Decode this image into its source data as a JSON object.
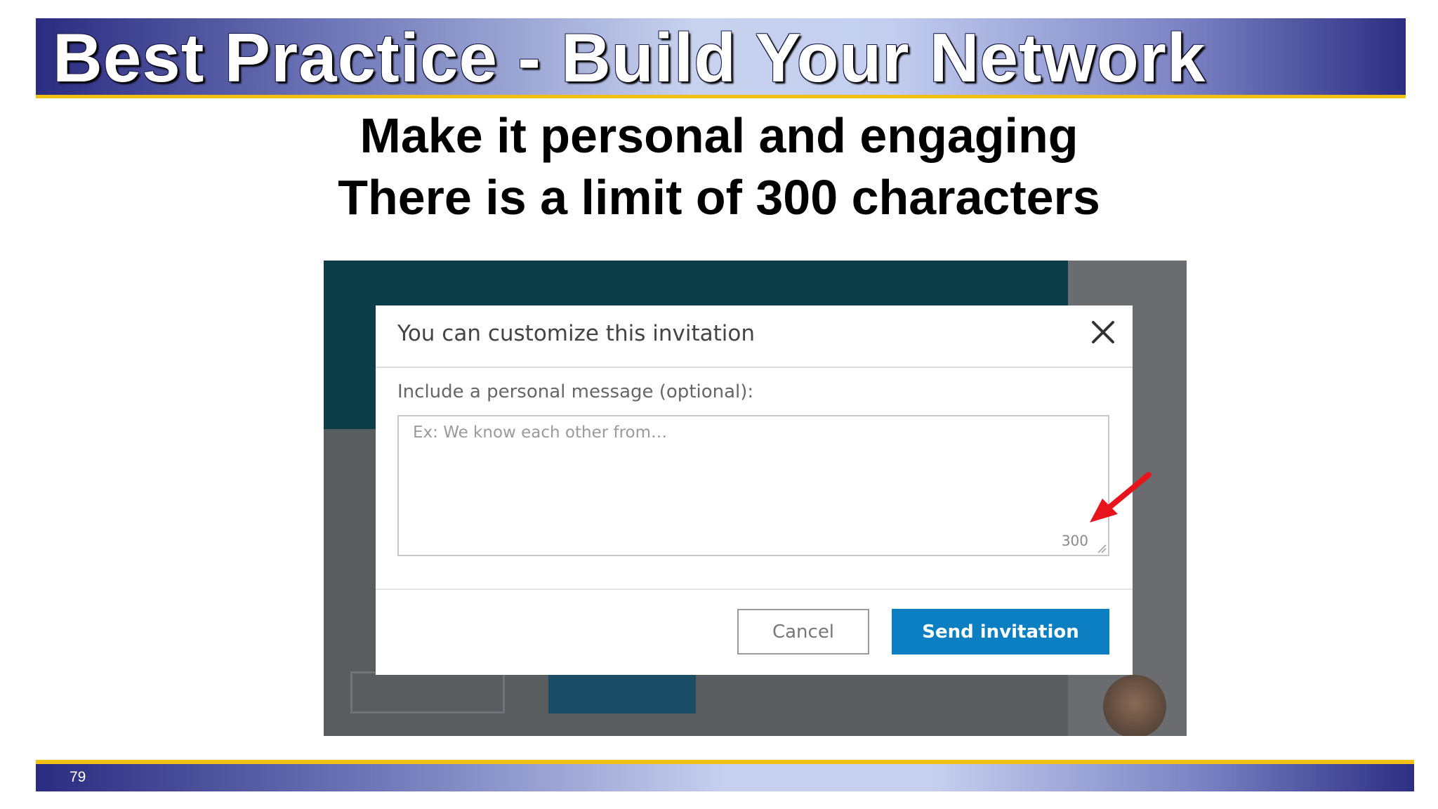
{
  "slide": {
    "title": "Best Practice - Build Your Network",
    "subtitle_line1": "Make it personal and engaging",
    "subtitle_line2": "There is a limit of 300 characters",
    "page_number": "79"
  },
  "dialog": {
    "title": "You can customize this invitation",
    "prompt_label": "Include a personal message (optional):",
    "message_placeholder": "Ex: We know each other from…",
    "message_value": "",
    "char_counter": "300",
    "cancel_label": "Cancel",
    "send_label": "Send invitation"
  },
  "colors": {
    "title_bar_dark": "#2a2c80",
    "accent_gold": "#f2c012",
    "send_button": "#0b7fc1",
    "annotation_arrow": "#e8141c"
  },
  "icons": {
    "close": "close-icon",
    "resize": "resize-handle-icon",
    "arrow": "red-arrow-icon"
  }
}
